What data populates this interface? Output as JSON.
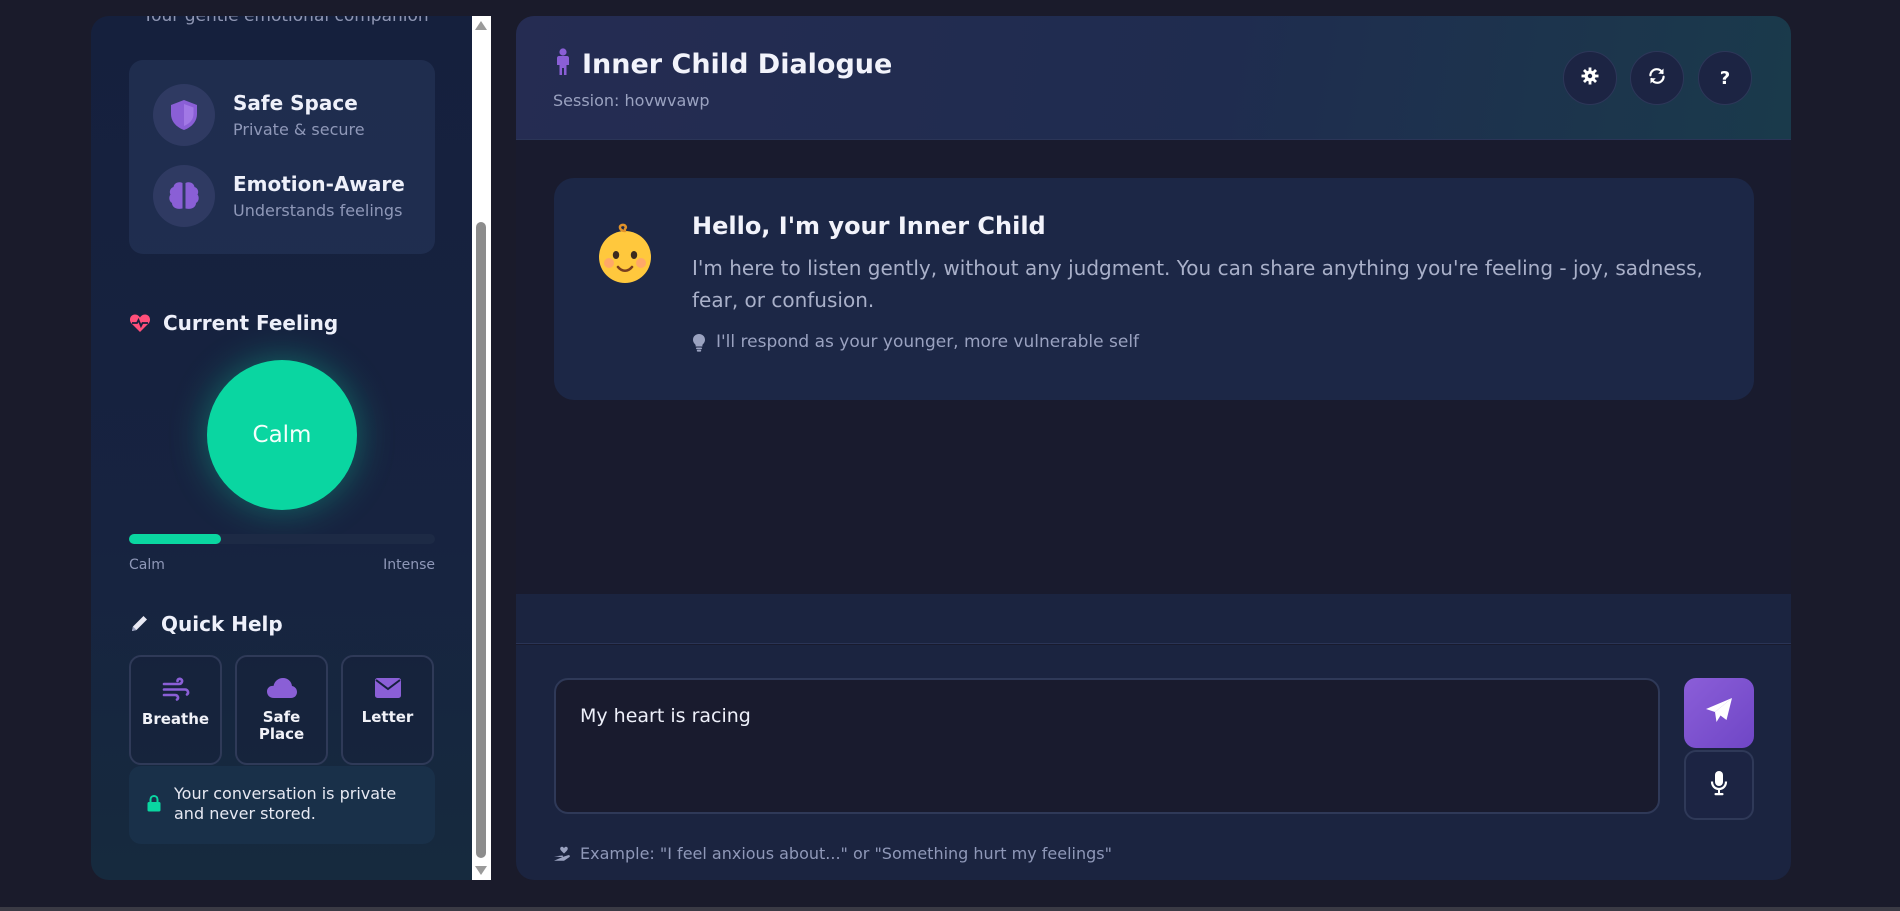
{
  "sidebar": {
    "tagline": "Your gentle emotional companion",
    "features": [
      {
        "title": "Safe Space",
        "subtitle": "Private & secure",
        "icon": "shield-icon"
      },
      {
        "title": "Emotion-Aware",
        "subtitle": "Understands feelings",
        "icon": "brain-icon"
      }
    ],
    "feeling": {
      "title": "Current Feeling",
      "icon": "heart-pulse-icon",
      "mood": "Calm",
      "intensity_fraction": 0.3,
      "low_label": "Calm",
      "high_label": "Intense"
    },
    "quick_help": {
      "title": "Quick Help",
      "icon": "pencil-icon",
      "buttons": [
        {
          "label": "Breathe",
          "icon": "wind-icon"
        },
        {
          "label": "Safe Place",
          "icon": "cloud-icon"
        },
        {
          "label": "Letter",
          "icon": "envelope-icon"
        }
      ]
    },
    "privacy_note": "Your conversation is private and never stored."
  },
  "header": {
    "title": "Inner Child Dialogue",
    "session": "Session: hovwvawp",
    "icon": "child-icon",
    "buttons": [
      {
        "name": "settings",
        "icon": "gear-icon"
      },
      {
        "name": "refresh",
        "icon": "refresh-icon"
      },
      {
        "name": "help",
        "label": "?",
        "icon": "question-icon"
      }
    ]
  },
  "welcome": {
    "emoji": "baby-face-icon",
    "title": "Hello, I'm your Inner Child",
    "body": "I'm here to listen gently, without any judgment. You can share anything you're feeling - joy, sadness, fear, or confusion.",
    "hint": "I'll respond as your younger, more vulnerable self"
  },
  "composer": {
    "value": "My heart is racing",
    "example": "Example: \"I feel anxious about...\" or \"Something hurt my feelings\""
  },
  "colors": {
    "accent_purple": "#8b5ed8",
    "calm_green": "#0ad6a1",
    "heart_pink": "#ff4f7a"
  }
}
